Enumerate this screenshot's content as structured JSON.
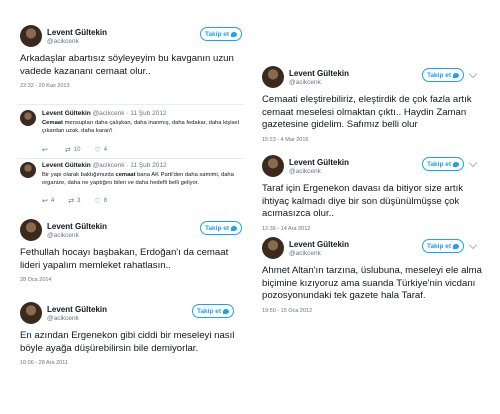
{
  "tweets": [
    {
      "name": "Levent Gültekin",
      "handle": "@acikcenk",
      "follow": "Takip et",
      "text": "Arkadaşlar abartısız söyleyeyim bu kavganın uzun vadede kazananı cemaat olur..",
      "time": "22:32 - 20 Kas 2013"
    },
    {
      "name": "Levent Gültekin",
      "handle": "@acikcenk",
      "follow": "Takip et",
      "text": "Fethullah hocayı başbakan, Erdoğan'ı da cemaat lideri yapalım memleket rahatlasın..",
      "time": "28 Oca 2014"
    },
    {
      "name": "Levent Gültekin",
      "handle": "@acikcenk",
      "follow": "Takip et",
      "text": "En azından Ergenekon gibi ciddi bir meseleyi nasıl böyle ayağa düşürebilirsin bile demiyorlar.",
      "time": "10:06 - 28 Ara 2011"
    },
    {
      "name": "Levent Gültekin",
      "handle": "@acikcenk",
      "follow": "Takip et",
      "text": "Cemaati eleştirebiliriz, eleştirdik de çok fazla artık cemaat meselesi olmaktan çıktı.. Haydin Zaman gazetesine gidelim. Safımız belli olur",
      "time": "15:23 - 4 Mar 2016"
    },
    {
      "name": "Levent Gültekin",
      "handle": "@acikcenk",
      "follow": "Takip et",
      "text": "Taraf için Ergenekon davası da bitiyor size artık ihtiyaç kalmadı diye bir son düşünülmüşse çok acımasızca olur..",
      "time": "12:36 - 14 Ara 2012"
    },
    {
      "name": "Levent Gültekin",
      "handle": "@acikcenk",
      "follow": "Takip et",
      "text": "Ahmet Altan'ın tarzına, üslubuna, meseleyi ele alma biçimine kızıyoruz ama suanda Türkiye'nin vicdanı pozosyonundaki tek gazete hala Taraf.",
      "time": "19:50 - 15 Oca 2012"
    }
  ],
  "quotes": [
    {
      "name": "Levent Gültekin",
      "handle": "@acikcenk · 11 Şub 2012",
      "text_bold": "Cemaat",
      "text": " mensupları daha çalışkan, daha inanmış, daha fedakar, daha kişisel çıkardan uzak, daha karar/\\",
      "replies": "",
      "retweets": "10",
      "likes": "4"
    },
    {
      "name": "Levent Gültekin",
      "handle": "@acikcenk · 11 Şub 2012",
      "text_pre": "Bir yapı olarak baktığımızda ",
      "text_bold": "cemaat",
      "text": " bana AK Parti'den daha samimi, daha organize, daha ne yaptığını bilen ve daha hedefli belli geliyor.",
      "replies": "4",
      "retweets": "3",
      "likes": "8"
    }
  ],
  "icons": {
    "reply": "reply-icon",
    "retweet": "retweet-icon",
    "like": "heart-icon",
    "follow": "twitter-bird-icon",
    "menu": "chevron-down-icon"
  },
  "colors": {
    "accent": "#1da1f2",
    "muted": "#657786",
    "text": "#14171a",
    "divider": "#e6ecf0"
  }
}
